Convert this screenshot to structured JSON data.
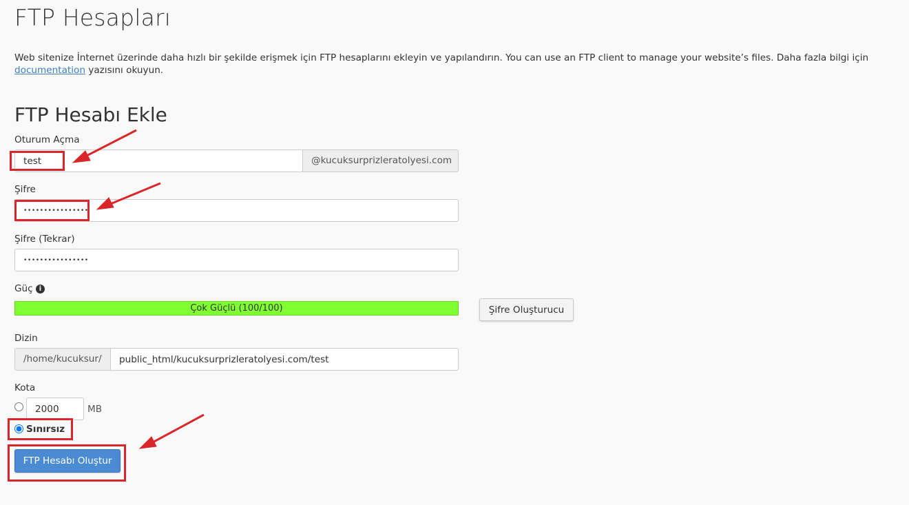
{
  "page": {
    "title": "FTP Hesapları",
    "description_before_link": "Web sitenize İnternet üzerinde daha hızlı bir şekilde erişmek için FTP hesaplarını ekleyin ve yapılandırın. You can use an FTP client to manage your website’s files. Daha fazla bilgi için ",
    "description_link": "documentation",
    "description_after_link": " yazısını okuyun."
  },
  "form": {
    "section_title": "FTP Hesabı Ekle",
    "login_label": "Oturum Açma",
    "login_value": "test",
    "login_domain": "@kucuksurprizleratolyesi.com",
    "password_label": "Şifre",
    "password_value": "••••••••••••••••",
    "password_repeat_label": "Şifre (Tekrar)",
    "password_repeat_value": "••••••••••••••••",
    "strength_label": "Güç",
    "strength_text": "Çok Güçlü (100/100)",
    "strength_value": 100,
    "generator_button": "Şifre Oluşturucu",
    "directory_label": "Dizin",
    "directory_prefix": "/home/kucuksur/",
    "directory_value": "public_html/kucuksurprizleratolyesi.com/test",
    "quota_label": "Kota",
    "quota_value": "2000",
    "quota_unit": "MB",
    "unlimited_label": "Sınırsız",
    "submit_button": "FTP Hesabı Oluştur"
  },
  "colors": {
    "strength_bar": "#80ff33",
    "primary_button": "#4a8bd4",
    "annotation_red": "#d8262a",
    "link": "#3e7fb8"
  }
}
